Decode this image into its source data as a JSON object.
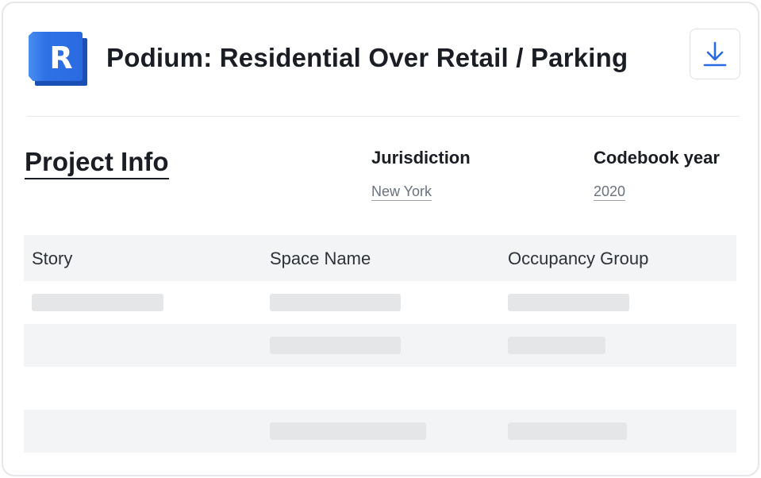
{
  "header": {
    "logo_letter": "R",
    "title": "Podium: Residential Over Retail / Parking",
    "download_icon": "download-icon"
  },
  "project_info": {
    "title": "Project Info",
    "jurisdiction_label": "Jurisdiction",
    "jurisdiction_value": "New York",
    "codebook_label": "Codebook year",
    "codebook_value": "2020"
  },
  "table": {
    "columns": [
      "Story",
      "Space Name",
      "Occupancy Group"
    ]
  },
  "colors": {
    "accent": "#2a6ae0",
    "logo_dark": "#1a4fb3",
    "header_bg": "#f3f4f5",
    "skeleton": "#e5e6e8"
  }
}
